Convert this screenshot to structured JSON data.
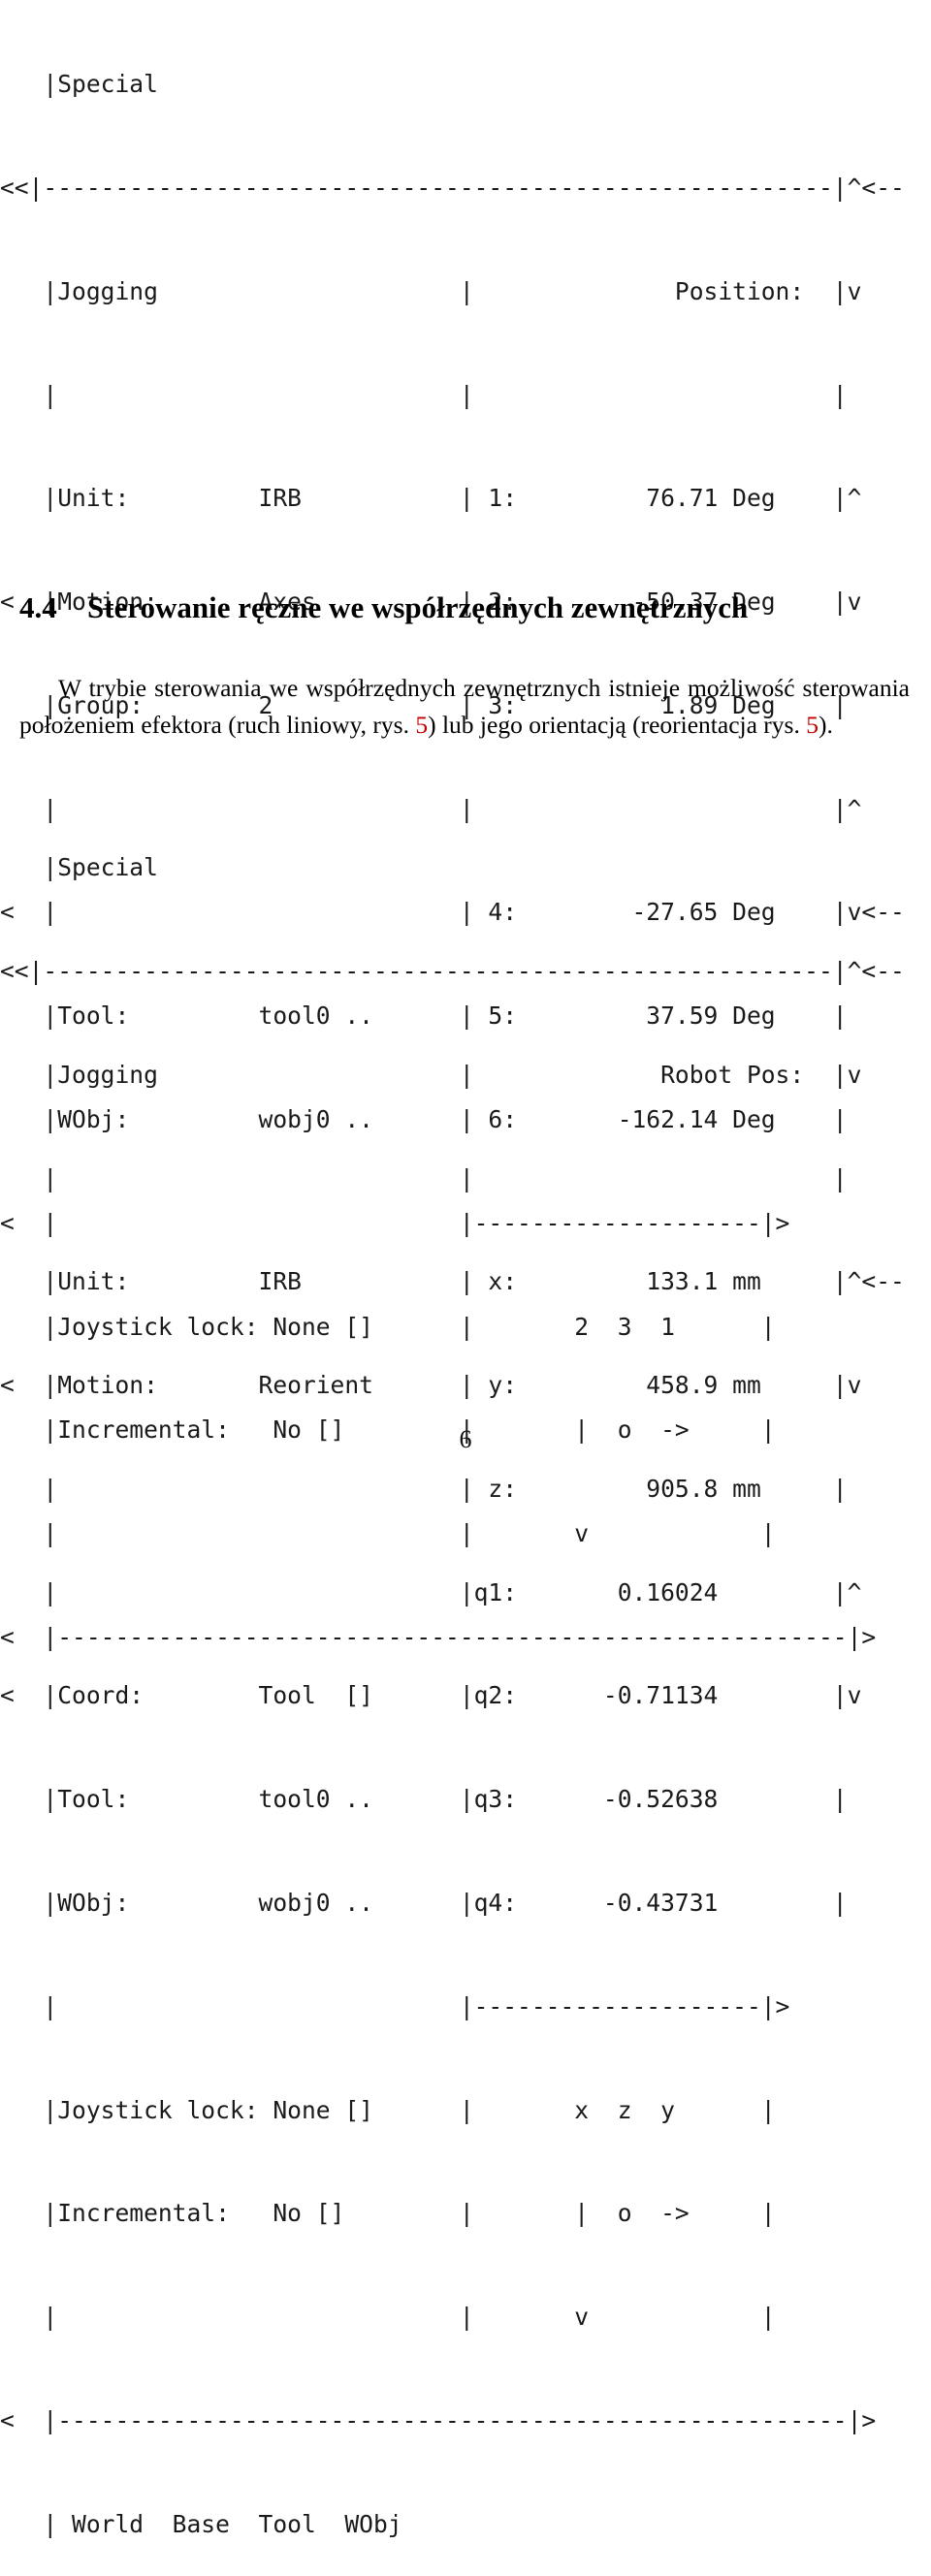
{
  "page": {
    "number": "6",
    "language": "pl"
  },
  "figure_axes": {
    "caption_label": "Special",
    "title": "Jogging",
    "readout_title": "Position:",
    "fields": [
      {
        "label": "Unit:",
        "value": "IRB"
      },
      {
        "label": "Motion:",
        "value": "Axes"
      },
      {
        "label": "Group:",
        "value": "2"
      },
      {
        "label": "Tool:",
        "value": "tool0 .."
      },
      {
        "label": "WObj:",
        "value": "wobj0 .."
      },
      {
        "label": "Joystick lock:",
        "value": "None []"
      },
      {
        "label": "Incremental:",
        "value": "No []"
      }
    ],
    "readouts": [
      {
        "axis": "1:",
        "value": "76.71",
        "unit": "Deg"
      },
      {
        "axis": "2:",
        "value": "-50.37",
        "unit": "Deg"
      },
      {
        "axis": "3:",
        "value": "1.89",
        "unit": "Deg"
      },
      {
        "axis": "4:",
        "value": "-27.65",
        "unit": "Deg"
      },
      {
        "axis": "5:",
        "value": "37.59",
        "unit": "Deg"
      },
      {
        "axis": "6:",
        "value": "-162.14",
        "unit": "Deg"
      }
    ],
    "joystick_axes": [
      "2",
      "3",
      "1"
    ],
    "joystick_glyphs": [
      "|",
      "o",
      "->",
      "v"
    ],
    "scroll_markers": [
      "<<",
      "^<--",
      "v",
      "^",
      "v<--",
      "<",
      ">"
    ],
    "lines": [
      "   |Special",
      "<<|-------------------------------------------------------|^<--",
      "   |Jogging                     |              Position:  |v",
      "   |                            |                         |",
      "   |Unit:         IRB           | 1:         76.71 Deg    |^",
      "<  |Motion:       Axes          | 2:        -50.37 Deg    |v",
      "   |Group:        2             | 3:          1.89 Deg    |",
      "   |                            |                         |^",
      "<  |                            | 4:        -27.65 Deg    |v<--",
      "   |Tool:         tool0 ..      | 5:         37.59 Deg    |",
      "   |WObj:         wobj0 ..      | 6:       -162.14 Deg    |",
      "<  |                            |--------------------|>",
      "   |Joystick lock: None []      |       2  3  1      |",
      "   |Incremental:   No []        |       |  o  ->     |",
      "   |                            |       v            |",
      "<  |-------------------------------------------------------|>"
    ]
  },
  "section": {
    "number": "4.4",
    "title": "Sterowanie ręczne we współrzędnych zewnętrznych",
    "paragraph_part1": "W trybie sterowania we współrzędnych zewnętrznych istnieje możliwość sterowania położeniem efektora (ruch liniowy, rys. ",
    "ref1": "5",
    "paragraph_part2": ") lub jego orientacją (reorientacja rys. ",
    "ref2": "5",
    "paragraph_part3": ")."
  },
  "figure_reorient": {
    "caption_label": "Special",
    "title": "Jogging",
    "readout_title": "Robot Pos:",
    "fields": [
      {
        "label": "Unit:",
        "value": "IRB"
      },
      {
        "label": "Motion:",
        "value": "Reorient"
      },
      {
        "label": "Coord:",
        "value": "Tool  []"
      },
      {
        "label": "Tool:",
        "value": "tool0 .."
      },
      {
        "label": "WObj:",
        "value": "wobj0 .."
      },
      {
        "label": "Joystick lock:",
        "value": "None []"
      },
      {
        "label": "Incremental:",
        "value": "No []"
      }
    ],
    "readouts": [
      {
        "axis": "x:",
        "value": "133.1",
        "unit": "mm"
      },
      {
        "axis": "y:",
        "value": "458.9",
        "unit": "mm"
      },
      {
        "axis": "z:",
        "value": "905.8",
        "unit": "mm"
      },
      {
        "axis": "q1:",
        "value": "0.16024",
        "unit": ""
      },
      {
        "axis": "q2:",
        "value": "-0.71134",
        "unit": ""
      },
      {
        "axis": "q3:",
        "value": "-0.52638",
        "unit": ""
      },
      {
        "axis": "q4:",
        "value": "-0.43731",
        "unit": ""
      }
    ],
    "joystick_axes": [
      "x",
      "z",
      "y"
    ],
    "joystick_glyphs": [
      "|",
      "o",
      "->",
      "v"
    ],
    "softkeys": [
      "World",
      "Base",
      "Tool",
      "WObj"
    ],
    "lines": [
      "   |Special",
      "<<|-------------------------------------------------------|^<--",
      "   |Jogging                     |             Robot Pos:  |v",
      "   |                            |                         |",
      "   |Unit:         IRB           | x:         133.1 mm     |^<--",
      "<  |Motion:       Reorient      | y:         458.9 mm     |v",
      "   |                            | z:         905.8 mm     |",
      "   |                            |q1:       0.16024        |^",
      "<  |Coord:        Tool  []      |q2:      -0.71134        |v",
      "   |Tool:         tool0 ..      |q3:      -0.52638        |",
      "   |WObj:         wobj0 ..      |q4:      -0.43731        |",
      "   |                            |--------------------|>",
      "   |Joystick lock: None []      |       x  z  y      |",
      "   |Incremental:   No []        |       |  o  ->     |",
      "   |                            |       v            |",
      "<  |-------------------------------------------------------|>",
      "   | World  Base  Tool  WObj"
    ]
  }
}
